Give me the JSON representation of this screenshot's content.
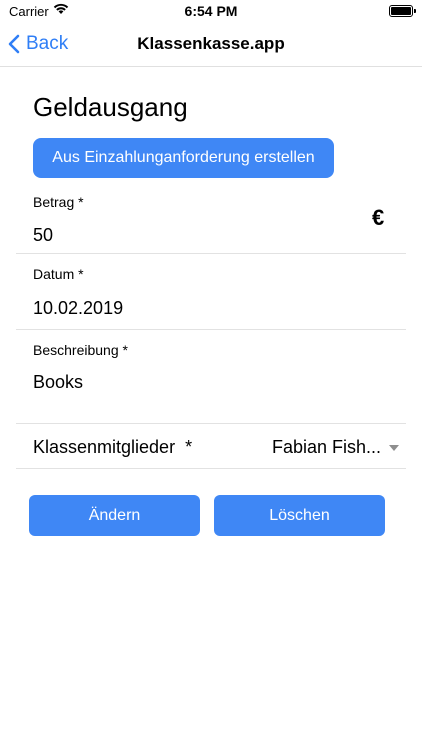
{
  "status_bar": {
    "carrier": "Carrier",
    "time": "6:54 PM"
  },
  "nav": {
    "back_label": "Back",
    "title": "Klassenkasse.app"
  },
  "page": {
    "title": "Geldausgang",
    "create_button_label": "Aus Einzahlunganforderung erstellen"
  },
  "form": {
    "betrag": {
      "label": "Betrag *",
      "value": "50",
      "currency_symbol": "€"
    },
    "datum": {
      "label": "Datum *",
      "value": "10.02.2019"
    },
    "beschreibung": {
      "label": "Beschreibung *",
      "value": "Books"
    },
    "klassenmitglieder": {
      "label": "Klassenmitglieder  *",
      "selected": "Fabian Fish..."
    }
  },
  "actions": {
    "change_label": "Ändern",
    "delete_label": "Löschen"
  },
  "colors": {
    "accent": "#3f87f5",
    "link": "#2f7ef6",
    "divider": "#e2e2e2"
  }
}
